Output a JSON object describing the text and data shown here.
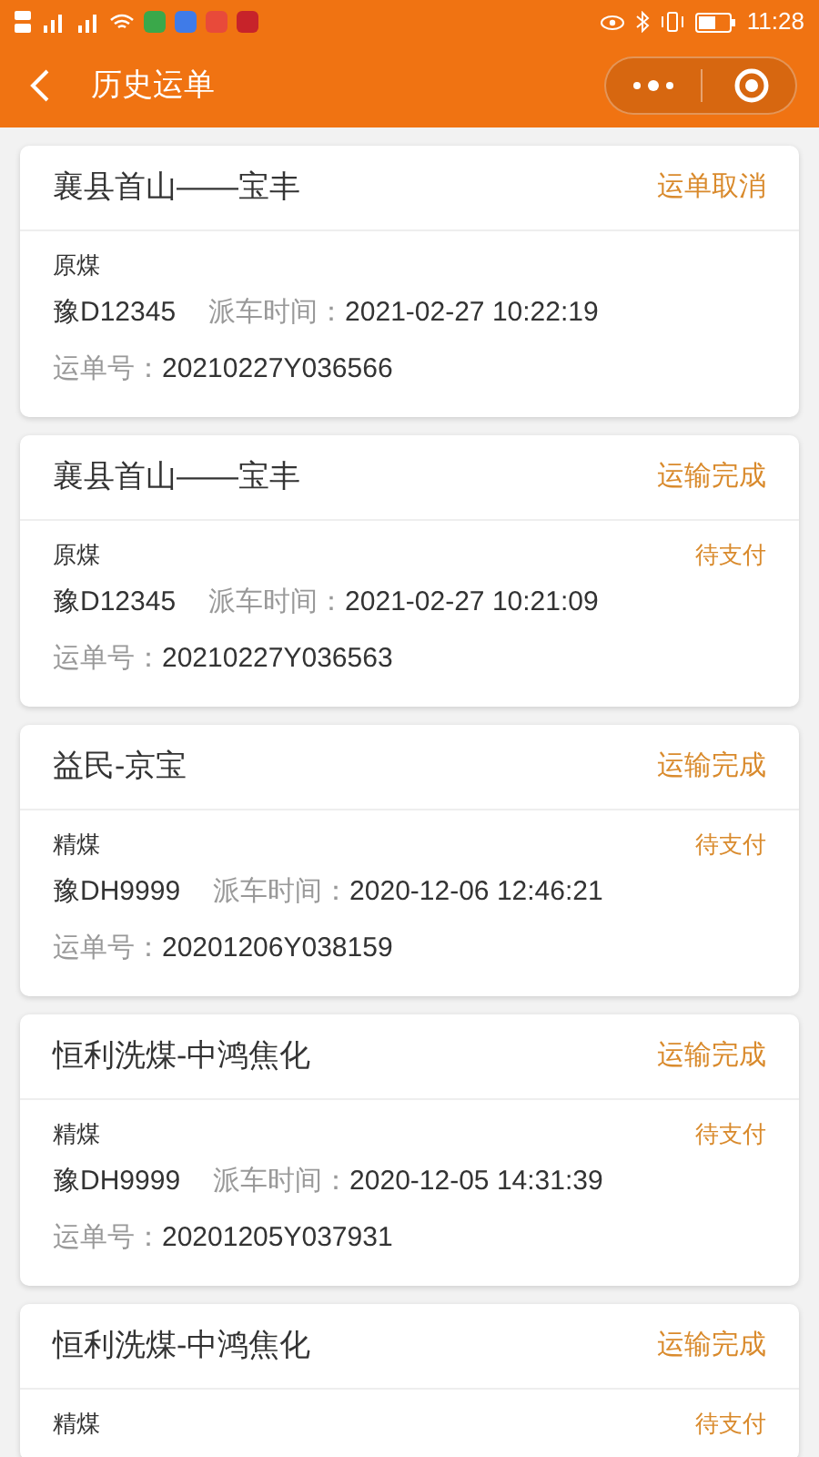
{
  "status_bar": {
    "time": "11:28"
  },
  "header": {
    "title": "历史运单"
  },
  "orders": [
    {
      "route": "襄县首山——宝丰",
      "status": "运单取消",
      "cargo": "原煤",
      "plate": "豫D12345",
      "dispatch_label": "派车时间：",
      "dispatch_time": "2021-02-27 10:22:19",
      "waybill_label": "运单号：",
      "waybill_no": "20210227Y036566"
    },
    {
      "route": "襄县首山——宝丰",
      "status": "运输完成",
      "cargo": "原煤",
      "payment": "待支付",
      "plate": "豫D12345",
      "dispatch_label": "派车时间：",
      "dispatch_time": "2021-02-27 10:21:09",
      "waybill_label": "运单号：",
      "waybill_no": "20210227Y036563"
    },
    {
      "route": "益民-京宝",
      "status": "运输完成",
      "cargo": "精煤",
      "payment": "待支付",
      "plate": "豫DH9999",
      "dispatch_label": "派车时间：",
      "dispatch_time": "2020-12-06 12:46:21",
      "waybill_label": "运单号：",
      "waybill_no": "20201206Y038159"
    },
    {
      "route": "恒利洗煤-中鸿焦化",
      "status": "运输完成",
      "cargo": "精煤",
      "payment": "待支付",
      "plate": "豫DH9999",
      "dispatch_label": "派车时间：",
      "dispatch_time": "2020-12-05 14:31:39",
      "waybill_label": "运单号：",
      "waybill_no": "20201205Y037931"
    },
    {
      "route": "恒利洗煤-中鸿焦化",
      "status": "运输完成",
      "cargo": "精煤",
      "payment": "待支付"
    }
  ]
}
